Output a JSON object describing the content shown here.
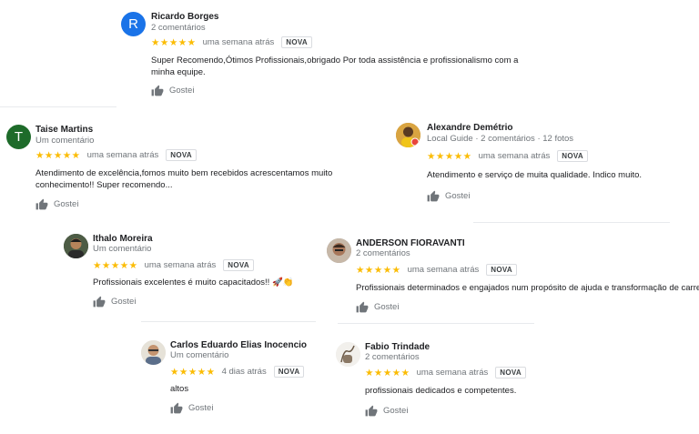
{
  "badge_label": "NOVA",
  "like_label": "Gostei",
  "stars": "★★★★★",
  "colors": {
    "star": "#fbbc04",
    "avatar_blue": "#1a73e8",
    "avatar_green": "#1e6b2a"
  },
  "reviews": [
    {
      "name": "Ricardo Borges",
      "meta": "2 comentários",
      "time": "uma semana atrás",
      "text": "Super Recomendo,Ótimos Profissionais,obrigado Por toda assistência  e profissionalismo com a minha equipe.",
      "avatar_letter": "R"
    },
    {
      "name": "Taise Martins",
      "meta": "Um comentário",
      "time": "uma semana atrás",
      "text": "Atendimento de excelência,fomos muito bem recebidos acrescentamos muito conhecimento!! Super recomendo...",
      "avatar_letter": "T"
    },
    {
      "name": "Alexandre Demétrio",
      "meta": "Local Guide · 2 comentários · 12 fotos",
      "time": "uma semana atrás",
      "text": "Atendimento e serviço de muita qualidade. Indico muito."
    },
    {
      "name": "Ithalo Moreira",
      "meta": "Um comentário",
      "time": "uma semana atrás",
      "text": "Profissionais excelentes é muito capacitados!! 🚀👏"
    },
    {
      "name": "ANDERSON FIORAVANTI",
      "meta": "2 comentários",
      "time": "uma semana atrás",
      "text": "Profissionais determinados e engajados num propósito de ajuda e transformação de carreiras."
    },
    {
      "name": "Carlos Eduardo Elias Inocencio",
      "meta": "Um comentário",
      "time": "4 dias atrás",
      "text": "altos"
    },
    {
      "name": "Fabio Trindade",
      "meta": "2 comentários",
      "time": "uma semana atrás",
      "text": "profissionais dedicados e competentes."
    }
  ]
}
